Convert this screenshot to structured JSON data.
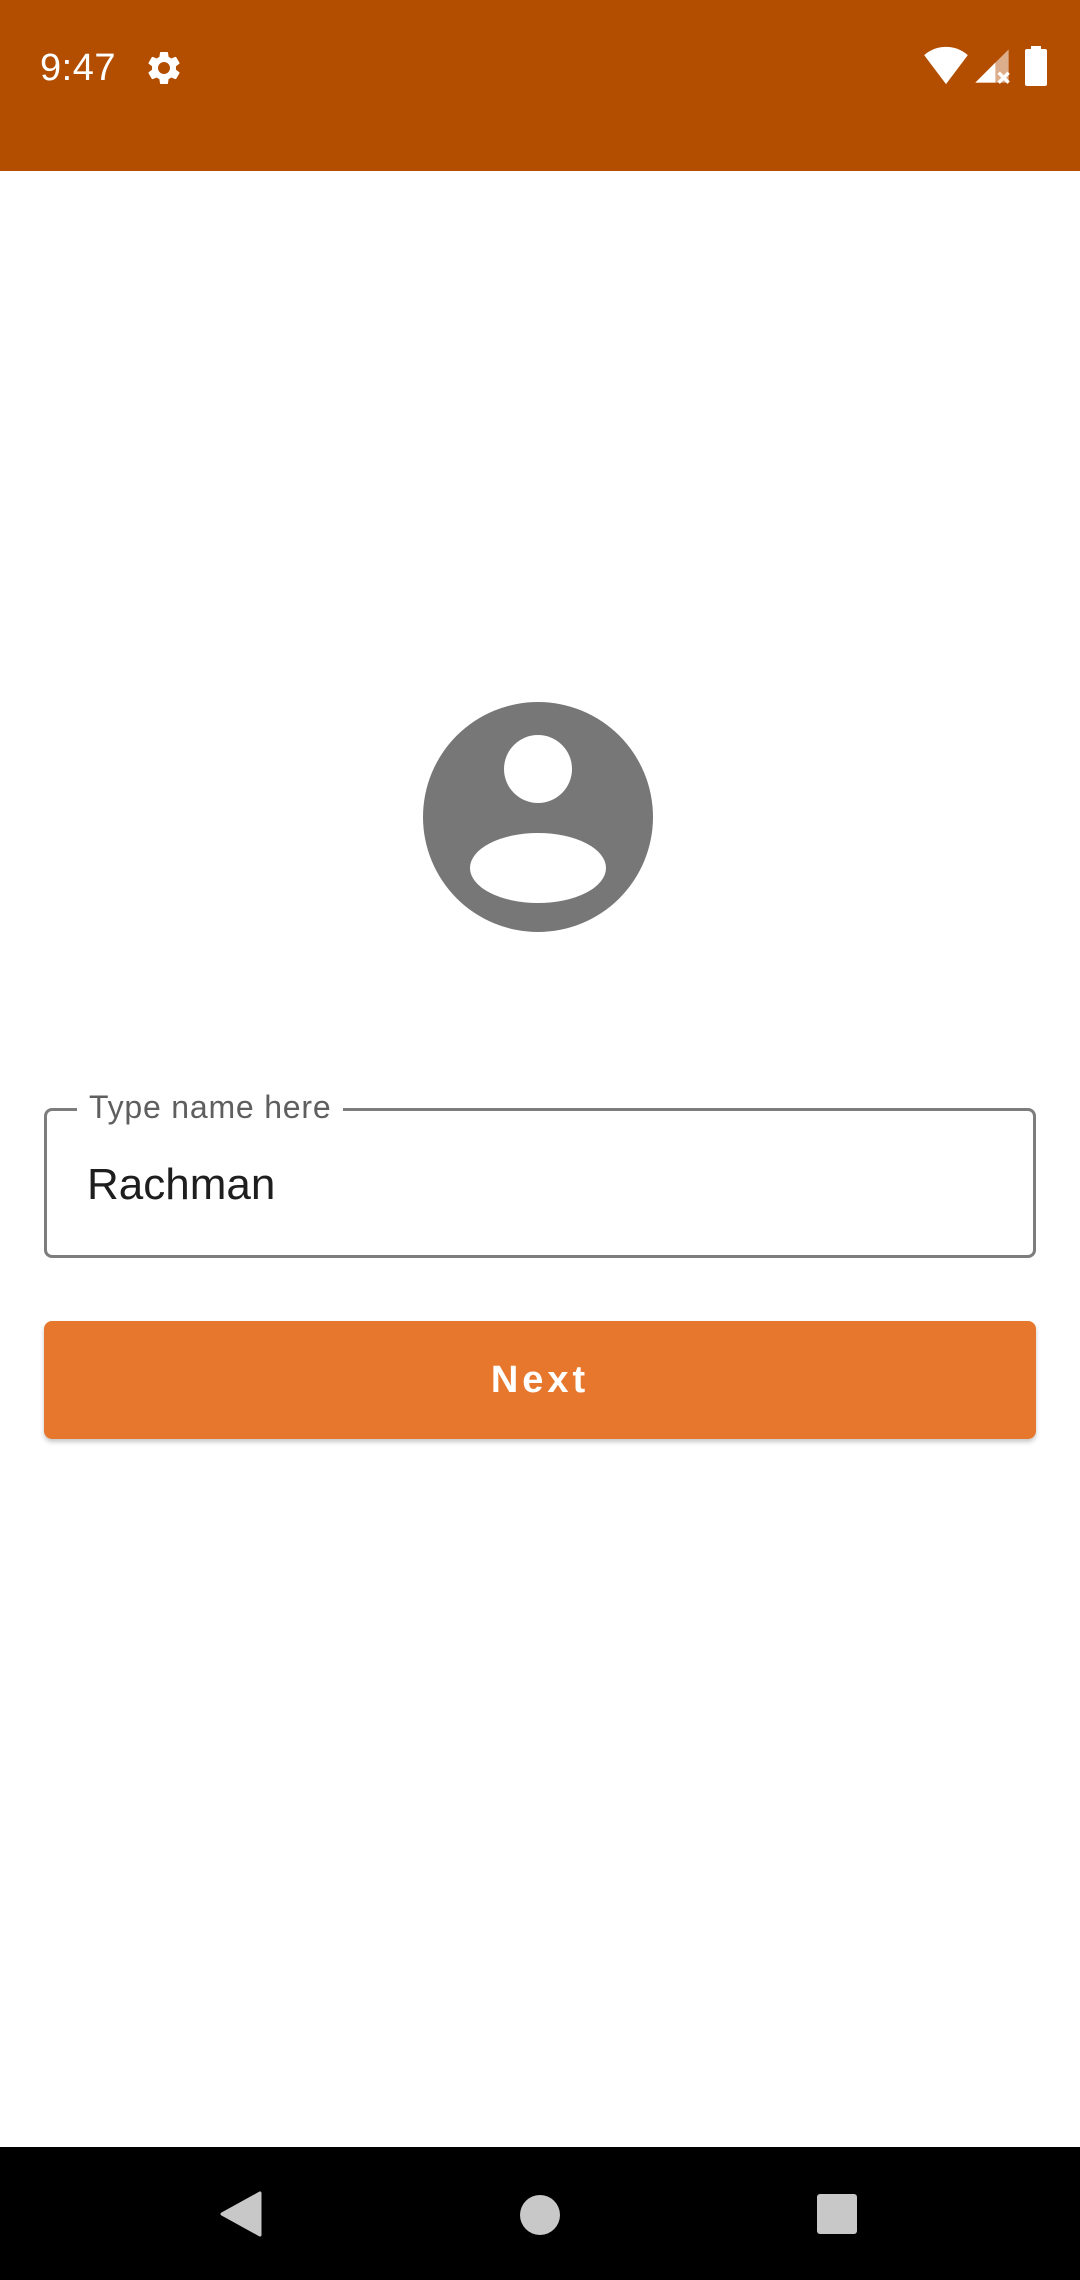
{
  "status_bar": {
    "time": "9:47",
    "background_color": "#b34d00",
    "icons": [
      "gear-icon",
      "wifi-icon",
      "cell-signal-icon",
      "battery-icon"
    ]
  },
  "avatar": {
    "icon": "person-avatar-icon",
    "color": "#777777"
  },
  "name_field": {
    "label": "Type name here",
    "value": "Rachman"
  },
  "next_button": {
    "label": "Next",
    "color": "#e8772e"
  },
  "nav_bar": {
    "icons": [
      "back-icon",
      "home-icon",
      "recents-icon"
    ]
  }
}
